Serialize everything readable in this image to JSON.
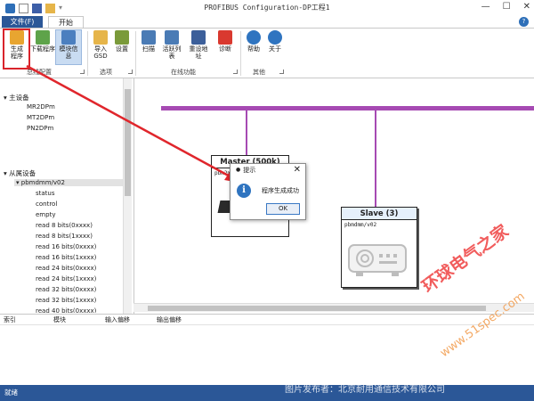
{
  "window": {
    "title": "PROFIBUS Configuration-DP工程1",
    "minimize": "—",
    "maximize": "☐",
    "close": "✕"
  },
  "tabs": {
    "file": "文件(F)",
    "start": "开始(H)"
  },
  "ribbon": {
    "generate": "生成\n程序",
    "download": "下载程序",
    "module_info": "模块信息",
    "import": "导入\nGSD",
    "settings": "设置",
    "scan": "扫描",
    "live_list": "活跃列表",
    "reset_address": "重设地址",
    "diagnose": "诊断",
    "help": "帮助",
    "about": "关于",
    "groups": {
      "bus_config": "总线配置",
      "options": "选项",
      "online": "在线功能",
      "other": "其他"
    }
  },
  "tree": {
    "master_header": "主设备",
    "masters": [
      "MR2DPm",
      "MT2DPm",
      "PN2DPm"
    ],
    "slave_header": "从属设备",
    "slave_device": "pbmdmm/v02",
    "slave_items": [
      "status",
      "control",
      "empty",
      "read 8 bits(0xxxx)",
      "read 8 bits(1xxxx)",
      "read 16 bits(0xxxx)",
      "read 16 bits(1xxxx)",
      "read 24 bits(0xxxx)",
      "read 24 bits(1xxxx)",
      "read 32 bits(0xxxx)",
      "read 32 bits(1xxxx)",
      "read 40 bits(0xxxx)",
      "read 40 bits(1xxxx)"
    ]
  },
  "canvas": {
    "master_title": "Master (500k)",
    "master_sub": "pbm2m",
    "slave_title": "Slave (3)",
    "slave_sub": "pbmdmm/v02",
    "bus_color": "#a64ab3"
  },
  "dialog": {
    "title": "提示",
    "message": "程序生成成功",
    "ok": "OK",
    "close": "✕"
  },
  "bottom": {
    "columns": [
      "索引",
      "模块",
      "输入偏移",
      "输出偏移"
    ]
  },
  "status": "就绪",
  "watermark": {
    "brand": "环球电气之家",
    "site": "www.51spec.com",
    "publisher": "图片发布者：北京耐用通信技术有限公司"
  },
  "colors": {
    "accent": "#2b5797",
    "highlight_red": "#d9232b",
    "bus": "#a64ab3"
  }
}
